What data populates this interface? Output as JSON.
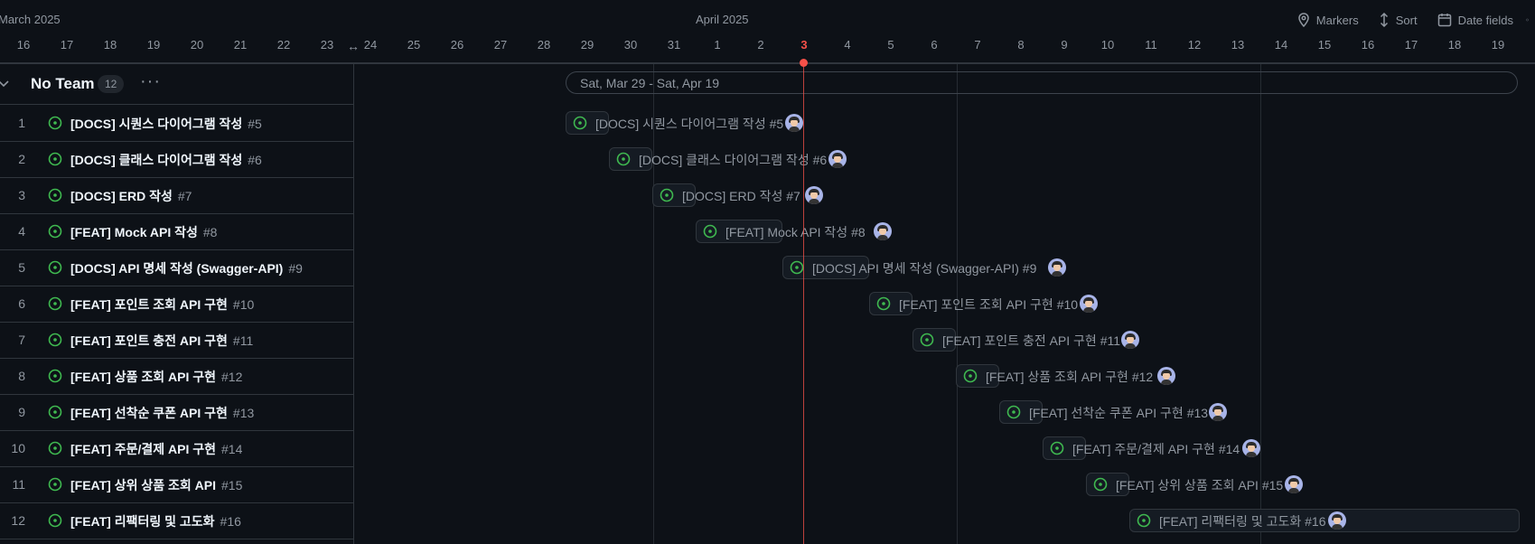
{
  "months": {
    "march": "March 2025",
    "april": "April 2025"
  },
  "toolbar": {
    "markers": "Markers",
    "sort": "Sort",
    "date_fields": "Date fields"
  },
  "days": [
    "16",
    "17",
    "18",
    "19",
    "20",
    "21",
    "22",
    "23",
    "24",
    "25",
    "26",
    "27",
    "28",
    "29",
    "30",
    "31",
    "1",
    "2",
    "3",
    "4",
    "5",
    "6",
    "7",
    "8",
    "9",
    "10",
    "11",
    "12",
    "13",
    "14",
    "15",
    "16",
    "17",
    "18",
    "19"
  ],
  "today_label": "3",
  "group": {
    "name": "No Team",
    "count": "12",
    "menu": "···"
  },
  "date_range": "Sat, Mar 29 - Sat, Apr 19",
  "colors": {
    "accent_green": "#3fb950",
    "today_red": "#f85149",
    "background": "#0d1117"
  },
  "rows": [
    {
      "num": "1",
      "title": "[DOCS] 시퀀스 다이어그램 작성",
      "number": "#5"
    },
    {
      "num": "2",
      "title": "[DOCS] 클래스 다이어그램 작성",
      "number": "#6"
    },
    {
      "num": "3",
      "title": "[DOCS] ERD 작성",
      "number": "#7"
    },
    {
      "num": "4",
      "title": "[FEAT] Mock API 작성",
      "number": "#8"
    },
    {
      "num": "5",
      "title": "[DOCS] API 명세 작성 (Swagger-API)",
      "number": "#9"
    },
    {
      "num": "6",
      "title": "[FEAT] 포인트 조회 API 구현",
      "number": "#10"
    },
    {
      "num": "7",
      "title": "[FEAT] 포인트 충전 API 구현",
      "number": "#11"
    },
    {
      "num": "8",
      "title": "[FEAT] 상품 조회 API 구현",
      "number": "#12"
    },
    {
      "num": "9",
      "title": "[FEAT] 선착순 쿠폰 API 구현",
      "number": "#13"
    },
    {
      "num": "10",
      "title": "[FEAT] 주문/결제 API 구현",
      "number": "#14"
    },
    {
      "num": "11",
      "title": "[FEAT] 상위 상품 조회 API",
      "number": "#15"
    },
    {
      "num": "12",
      "title": "[FEAT] 리팩터링 및 고도화",
      "number": "#16"
    }
  ],
  "bars": [
    {
      "label": "[DOCS] 시퀀스 다이어그램 작성 #5",
      "start": "Mar 29",
      "end": "Mar 29"
    },
    {
      "label": "[DOCS] 클래스 다이어그램 작성 #6",
      "start": "Mar 30",
      "end": "Mar 30"
    },
    {
      "label": "[DOCS] ERD 작성 #7",
      "start": "Mar 31",
      "end": "Mar 31"
    },
    {
      "label": "[FEAT] Mock API 작성 #8",
      "start": "Apr 1",
      "end": "Apr 2"
    },
    {
      "label": "[DOCS] API 명세 작성 (Swagger-API) #9",
      "start": "Apr 3",
      "end": "Apr 4"
    },
    {
      "label": "[FEAT] 포인트 조회 API 구현 #10",
      "start": "Apr 5",
      "end": "Apr 5"
    },
    {
      "label": "[FEAT] 포인트 충전 API 구현 #11",
      "start": "Apr 6",
      "end": "Apr 6"
    },
    {
      "label": "[FEAT] 상품 조회 API 구현 #12",
      "start": "Apr 7",
      "end": "Apr 7"
    },
    {
      "label": "[FEAT] 선착순 쿠폰 API 구현 #13",
      "start": "Apr 8",
      "end": "Apr 8"
    },
    {
      "label": "[FEAT] 주문/결제 API 구현 #14",
      "start": "Apr 9",
      "end": "Apr 9"
    },
    {
      "label": "[FEAT] 상위 상품 조회 API #15",
      "start": "Apr 10",
      "end": "Apr 10"
    },
    {
      "label": "[FEAT] 리팩터링 및 고도화 #16",
      "start": "Apr 11",
      "end": "Apr 19"
    }
  ]
}
